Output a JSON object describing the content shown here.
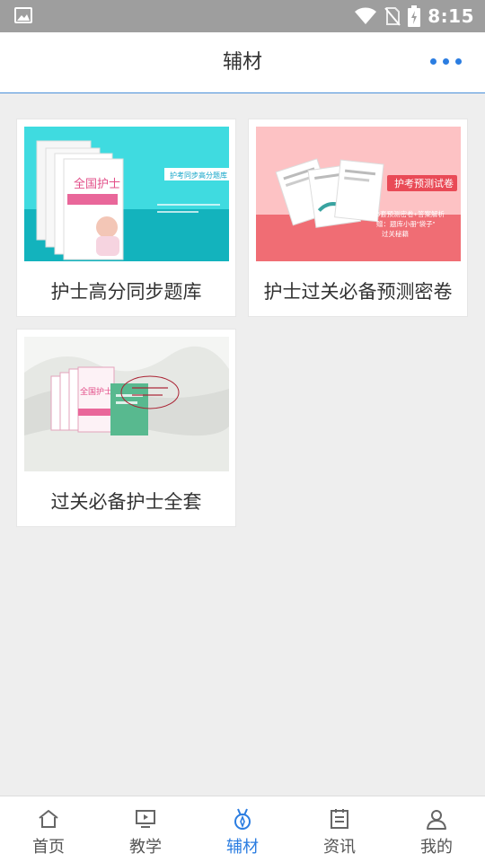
{
  "status_bar": {
    "time": "8:15"
  },
  "header": {
    "title": "辅材"
  },
  "cards": [
    {
      "label": "护士高分同步题库",
      "thumb": {
        "badge": "护考同步高分题库",
        "book_title": "全国护士"
      }
    },
    {
      "label": "护士过关必备预测密卷",
      "thumb": {
        "badge": "护考预测试卷",
        "line1": "5套预测密卷+答案解析",
        "line2": "赠：题库小册\"袋子\"",
        "line3": "过关秘籍"
      }
    },
    {
      "label": "过关必备护士全套",
      "thumb": {
        "book_title": "全国护士"
      }
    }
  ],
  "tabs": [
    {
      "label": "首页",
      "icon": "home-icon"
    },
    {
      "label": "教学",
      "icon": "video-icon"
    },
    {
      "label": "辅材",
      "icon": "medal-icon"
    },
    {
      "label": "资讯",
      "icon": "news-icon"
    },
    {
      "label": "我的",
      "icon": "user-icon"
    }
  ],
  "colors": {
    "accent": "#2b7de1",
    "status_bar": "#9e9e9e"
  }
}
